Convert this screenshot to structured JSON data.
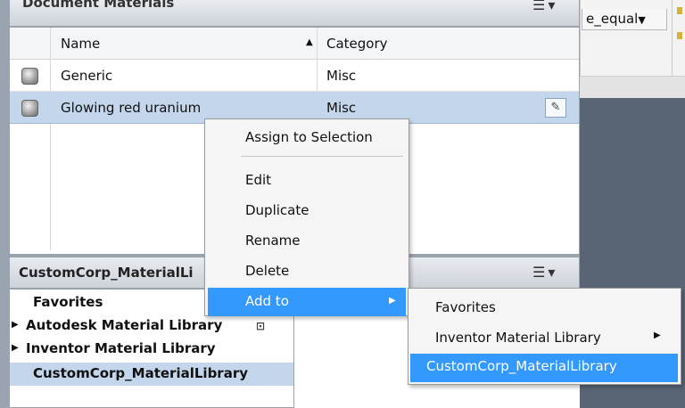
{
  "document_panel": {
    "title": "Document Materials",
    "list_icon": "list-icon",
    "columns": {
      "name": "Name",
      "category": "Category",
      "sort_indicator": "▲"
    },
    "rows": [
      {
        "name": "Generic",
        "category": "Misc"
      },
      {
        "name": "Glowing red uranium",
        "category": "Misc"
      }
    ],
    "edit_icon": "✎"
  },
  "library_panel": {
    "title": "CustomCorp_MaterialLi",
    "tree": [
      {
        "label": "Favorites",
        "expandable": false
      },
      {
        "label": "Autodesk Material Library",
        "expandable": true
      },
      {
        "label": "Inventor Material Library",
        "expandable": true
      },
      {
        "label": "CustomCorp_MaterialLibrary",
        "expandable": false,
        "selected": true
      }
    ]
  },
  "context_menu": {
    "items": [
      {
        "label": "Assign to Selection"
      },
      {
        "label": "Edit"
      },
      {
        "label": "Duplicate"
      },
      {
        "label": "Rename"
      },
      {
        "label": "Delete"
      },
      {
        "label": "Add to",
        "has_submenu": true,
        "highlighted": true
      }
    ]
  },
  "submenu": {
    "items": [
      {
        "label": "Favorites"
      },
      {
        "label": "Inventor Material Library",
        "has_submenu": true
      },
      {
        "label": "CustomCorp_MaterialLibrary",
        "highlighted": true
      }
    ]
  },
  "toolbar": {
    "combo_value": "e_equal"
  },
  "icons": {
    "triangle_right": "▶",
    "triangle_down": "▾",
    "list": "☰"
  },
  "colors": {
    "highlight": "#3399ff",
    "selection": "#c4d6ec",
    "viewport": "#596575"
  }
}
